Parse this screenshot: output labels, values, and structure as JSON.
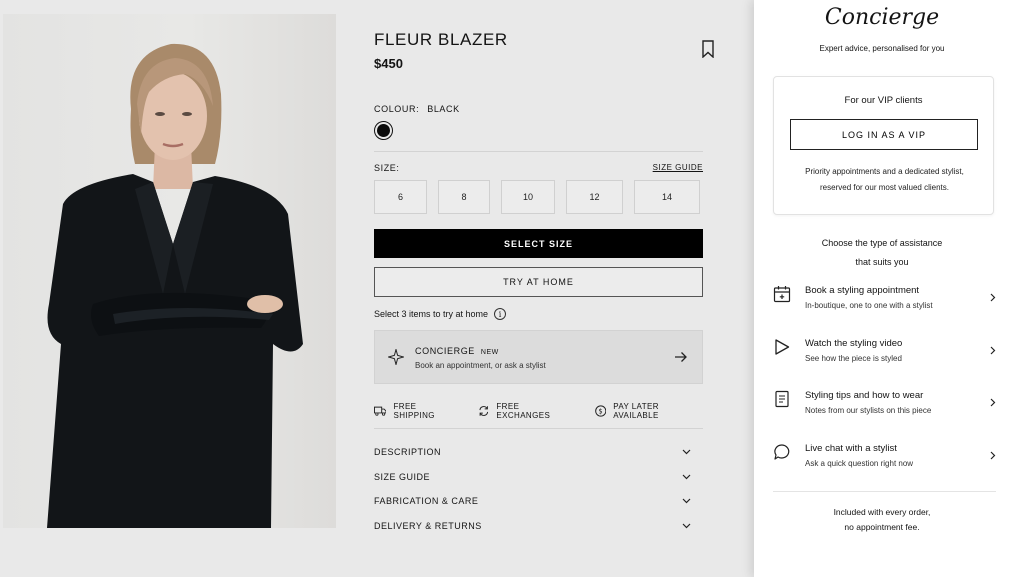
{
  "product": {
    "title": "FLEUR BLAZER",
    "price": "$450",
    "colour_label": "COLOUR:",
    "colour_value": "BLACK",
    "swatch_color": "#0b0b0b",
    "size_label": "SIZE:",
    "size_guide_link": "SIZE GUIDE",
    "sizes": [
      "6",
      "8",
      "10",
      "12",
      "14"
    ],
    "select_size_button": "SELECT SIZE",
    "try_at_home_button": "TRY AT HOME",
    "try_at_home_note": "Select 3 items to try at home"
  },
  "concierge_card": {
    "title": "CONCIERGE",
    "badge": "NEW",
    "subtitle": "Book an appointment, or ask a stylist"
  },
  "perks": [
    {
      "label": "FREE SHIPPING",
      "icon": "truck-icon"
    },
    {
      "label": "FREE EXCHANGES",
      "icon": "exchange-icon"
    },
    {
      "label": "PAY LATER AVAILABLE",
      "icon": "dollar-icon"
    }
  ],
  "accordion": [
    "DESCRIPTION",
    "SIZE GUIDE",
    "FABRICATION & CARE",
    "DELIVERY & RETURNS"
  ],
  "panel": {
    "title": "Concierge",
    "subtitle": "Expert advice, personalised for you",
    "vip": {
      "heading": "For our VIP clients",
      "button": "LOG IN AS A VIP",
      "desc_line1": "Priority appointments and a dedicated stylist,",
      "desc_line2": "reserved for our most valued clients."
    },
    "choose_line1": "Choose the type of assistance",
    "choose_line2": "that suits you",
    "options": [
      {
        "title": "Book a styling appointment",
        "subtitle": "In-boutique, one to one with a stylist",
        "icon": "calendar-icon"
      },
      {
        "title": "Watch the styling video",
        "subtitle": "See how the piece is styled",
        "icon": "play-icon"
      },
      {
        "title": "Styling tips and how to wear",
        "subtitle": "Notes from our stylists on this piece",
        "icon": "notes-icon"
      },
      {
        "title": "Live chat with a stylist",
        "subtitle": "Ask a quick question right now",
        "icon": "chat-icon"
      }
    ],
    "footer_line1": "Included with every order,",
    "footer_line2": "no appointment fee."
  },
  "colors": {
    "page_bg": "#e9e9e9",
    "primary_button": "#000000",
    "panel_bg": "#ffffff"
  }
}
